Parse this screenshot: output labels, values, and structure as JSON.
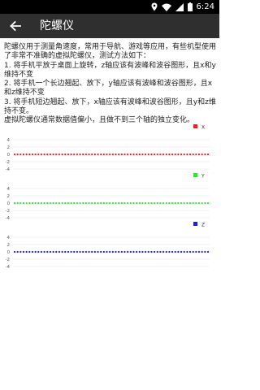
{
  "status_bar": {
    "time": "6:24",
    "icons": [
      "location-icon",
      "wifi-icon",
      "cellular-icon",
      "battery-icon"
    ]
  },
  "app_bar": {
    "back_icon": "arrow-back-icon",
    "title": "陀螺仪"
  },
  "description": {
    "line1": "陀螺仪用于测量角速度，常用于导航、游戏等应用，有些机型使用了非常不准确的虚拟陀螺仪，测试方法如下：",
    "line2": "1. 将手机平放于桌面上旋转，z轴应该有波峰和波谷图形，且x和y维持不变",
    "line3": "2. 将手机一个长边翘起、放下，y轴应该有波峰和波谷图形，且x和z维持不变",
    "line4": "3. 将手机短边翘起、放下，x轴应该有波峰和波谷图形，且y和z维持不变。",
    "line5": "虚拟陀螺仪通常数据值偏小，且做不到三个轴的独立变化。"
  },
  "colors": {
    "x_series": "#e8202a",
    "y_series": "#2ee82e",
    "z_series": "#2020d0",
    "axis_text": "#555555",
    "grid": "#dddddd"
  },
  "chart_data": [
    {
      "type": "scatter",
      "legend": "X",
      "legend_position": "top-right",
      "color": "#e8202a",
      "yticks": [
        "4",
        "2",
        "0",
        "-2",
        "-4"
      ],
      "ylim": [
        -4,
        4
      ],
      "constant_value": 0,
      "point_count": 66
    },
    {
      "type": "scatter",
      "legend": "Y",
      "legend_position": "top-right",
      "color": "#2ee82e",
      "yticks": [
        "4",
        "2",
        "0",
        "-2",
        "-4"
      ],
      "ylim": [
        -4,
        4
      ],
      "constant_value": 0,
      "point_count": 66
    },
    {
      "type": "scatter",
      "legend": "Z",
      "legend_position": "top-right",
      "color": "#2020d0",
      "yticks": [
        "4",
        "2",
        "0",
        "-2",
        "-4"
      ],
      "ylim": [
        -4,
        4
      ],
      "constant_value": 0,
      "point_count": 66
    }
  ]
}
